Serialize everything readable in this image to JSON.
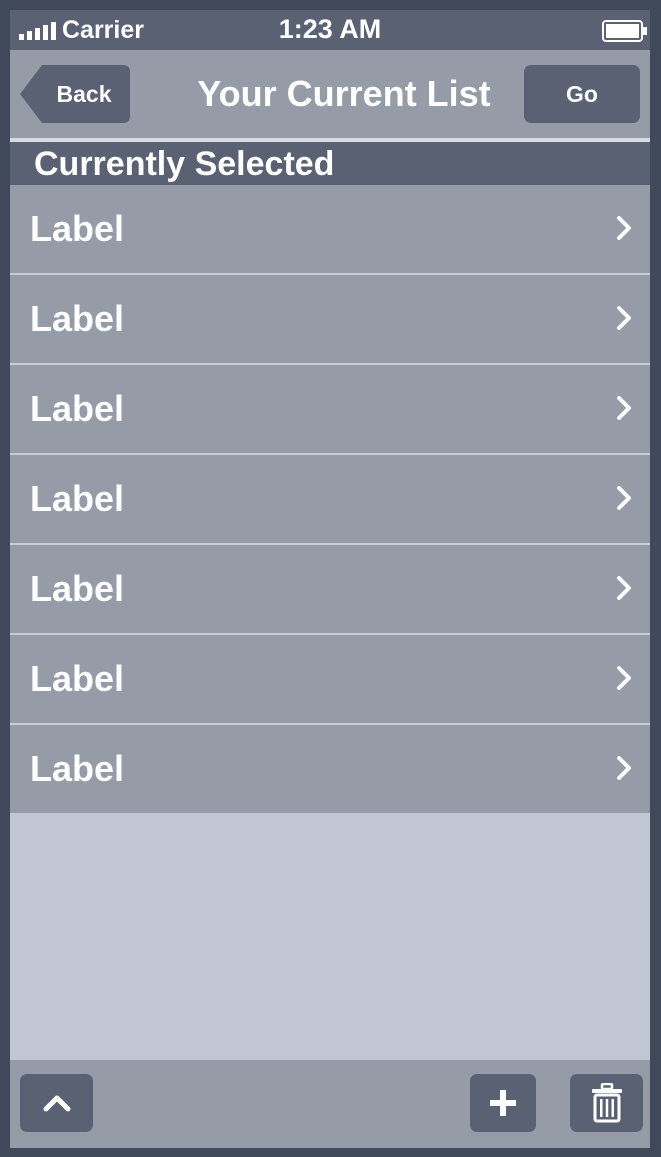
{
  "status_bar": {
    "carrier": "Carrier",
    "time": "1:23 AM",
    "signal_icon": "signal-bars-icon",
    "battery_icon": "battery-full-icon"
  },
  "nav_bar": {
    "back_label": "Back",
    "title": "Your Current List",
    "go_label": "Go"
  },
  "section": {
    "title": "Currently Selected"
  },
  "list": {
    "items": [
      {
        "label": "Label",
        "icon": "chevron-right-icon"
      },
      {
        "label": "Label",
        "icon": "chevron-right-icon"
      },
      {
        "label": "Label",
        "icon": "chevron-right-icon"
      },
      {
        "label": "Label",
        "icon": "chevron-right-icon"
      },
      {
        "label": "Label",
        "icon": "chevron-right-icon"
      },
      {
        "label": "Label",
        "icon": "chevron-right-icon"
      },
      {
        "label": "Label",
        "icon": "chevron-right-icon"
      }
    ]
  },
  "toolbar": {
    "up_icon": "chevron-up-icon",
    "add_icon": "plus-icon",
    "trash_icon": "trash-icon"
  },
  "colors": {
    "frame": "#3f495a",
    "bar_dark": "#596173",
    "bar_light": "#959ba7",
    "background": "#c0c6d3",
    "text": "#ffffff"
  }
}
